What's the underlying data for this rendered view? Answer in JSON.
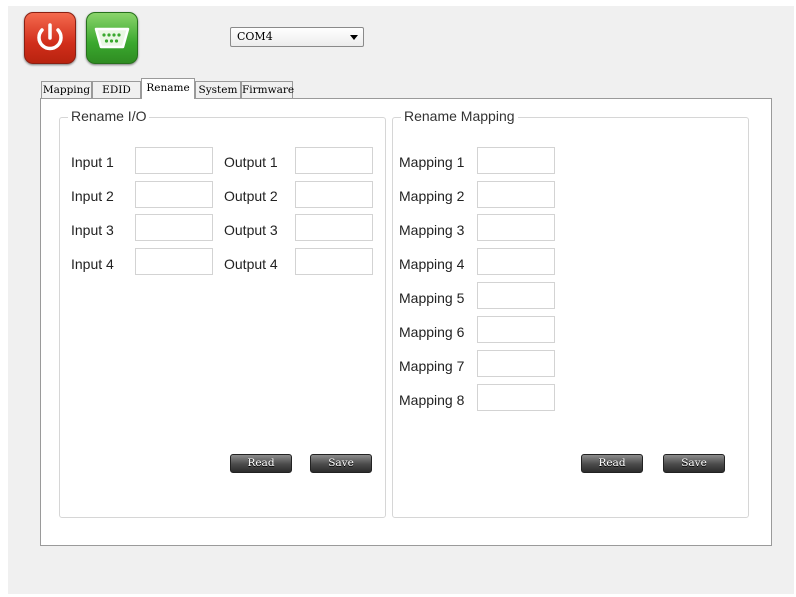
{
  "toolbar": {
    "power_button_icon": "power-icon",
    "serial_button_icon": "serial-port-icon",
    "com_port": {
      "selected": "COM4"
    }
  },
  "tabs": [
    {
      "label": "Mapping",
      "active": false
    },
    {
      "label": "EDID",
      "active": false
    },
    {
      "label": "Rename",
      "active": true
    },
    {
      "label": "System",
      "active": false
    },
    {
      "label": "Firmware",
      "active": false
    }
  ],
  "rename_io": {
    "title": "Rename I/O",
    "inputs": [
      {
        "label": "Input 1",
        "value": ""
      },
      {
        "label": "Input 2",
        "value": ""
      },
      {
        "label": "Input 3",
        "value": ""
      },
      {
        "label": "Input 4",
        "value": ""
      }
    ],
    "outputs": [
      {
        "label": "Output 1",
        "value": ""
      },
      {
        "label": "Output 2",
        "value": ""
      },
      {
        "label": "Output 3",
        "value": ""
      },
      {
        "label": "Output 4",
        "value": ""
      }
    ],
    "read_label": "Read",
    "save_label": "Save"
  },
  "rename_mapping": {
    "title": "Rename Mapping",
    "mappings": [
      {
        "label": "Mapping 1",
        "value": ""
      },
      {
        "label": "Mapping 2",
        "value": ""
      },
      {
        "label": "Mapping 3",
        "value": ""
      },
      {
        "label": "Mapping 4",
        "value": ""
      },
      {
        "label": "Mapping 5",
        "value": ""
      },
      {
        "label": "Mapping 6",
        "value": ""
      },
      {
        "label": "Mapping 7",
        "value": ""
      },
      {
        "label": "Mapping 8",
        "value": ""
      }
    ],
    "read_label": "Read",
    "save_label": "Save"
  },
  "colors": {
    "power_button": "#d12e1b",
    "serial_button": "#3aa82e",
    "button_dark": "#3a3a3a"
  }
}
